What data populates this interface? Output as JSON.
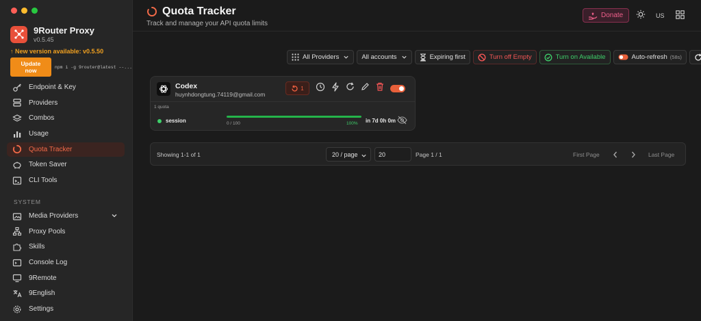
{
  "window": {
    "controls": [
      "#ff5f57",
      "#febc2e",
      "#28c840"
    ]
  },
  "brand": {
    "name": "9Router Proxy",
    "version": "v0.5.45",
    "accent": "#e8503a"
  },
  "update": {
    "notice": "↑ New version available: v0.5.50",
    "button": "Update now",
    "command": "npm i -g 9router@latest --..."
  },
  "sidebar": {
    "items": [
      {
        "label": "Endpoint & Key",
        "icon": "key-icon"
      },
      {
        "label": "Providers",
        "icon": "server-icon"
      },
      {
        "label": "Combos",
        "icon": "layers-icon"
      },
      {
        "label": "Usage",
        "icon": "bar-chart-icon"
      },
      {
        "label": "Quota Tracker",
        "icon": "quota-ring-icon",
        "active": true
      },
      {
        "label": "Token Saver",
        "icon": "piggy-bank-icon"
      },
      {
        "label": "CLI Tools",
        "icon": "terminal-icon"
      }
    ],
    "system_label": "SYSTEM",
    "system_items": [
      {
        "label": "Media Providers",
        "icon": "media-icon",
        "expandable": true
      },
      {
        "label": "Proxy Pools",
        "icon": "network-icon"
      },
      {
        "label": "Skills",
        "icon": "puzzle-icon"
      },
      {
        "label": "Console Log",
        "icon": "console-icon"
      },
      {
        "label": "9Remote",
        "icon": "monitor-icon"
      },
      {
        "label": "9English",
        "icon": "translate-icon"
      },
      {
        "label": "Settings",
        "icon": "gear-icon"
      }
    ]
  },
  "header": {
    "title": "Quota Tracker",
    "subtitle": "Track and manage your API quota limits",
    "donate": "Donate",
    "language": "US"
  },
  "toolbar": {
    "providers": "All Providers",
    "accounts": "All accounts",
    "sort": "Expiring first",
    "turn_off_empty": "Turn off Empty",
    "turn_on_available": "Turn on Available",
    "auto_refresh": "Auto-refresh",
    "auto_refresh_interval": "(58s)"
  },
  "card": {
    "name": "Codex",
    "email": "huynhdongtung.74119@gmail.com",
    "reset_count": "1",
    "enabled": true,
    "quota_count": "1 quota",
    "quota": {
      "name": "session",
      "used": "0 / 100",
      "percent_label": "100%",
      "remaining_fraction": 1.0,
      "reset_in": "in 7d 0h 0m"
    }
  },
  "pagination": {
    "showing": "Showing 1-1 of 1",
    "per_page": "20 / page",
    "page_input": "20",
    "page_info": "Page 1 / 1",
    "first": "First Page",
    "last": "Last Page"
  }
}
